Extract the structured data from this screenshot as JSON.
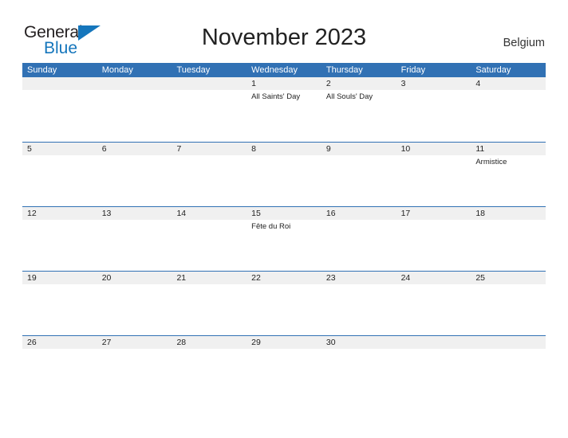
{
  "brand": {
    "name_part1": "General",
    "name_part2": "Blue",
    "triangle_color": "#1576bc",
    "text_color": "#231f20"
  },
  "header": {
    "title": "November 2023",
    "location": "Belgium",
    "header_bg_color": "#3171b4",
    "row_band_color": "#f0f0f0"
  },
  "weekdays": [
    "Sunday",
    "Monday",
    "Tuesday",
    "Wednesday",
    "Thursday",
    "Friday",
    "Saturday"
  ],
  "weeks": [
    {
      "days": [
        {
          "num": "",
          "events": []
        },
        {
          "num": "",
          "events": []
        },
        {
          "num": "",
          "events": []
        },
        {
          "num": "1",
          "events": [
            "All Saints' Day"
          ]
        },
        {
          "num": "2",
          "events": [
            "All Souls' Day"
          ]
        },
        {
          "num": "3",
          "events": []
        },
        {
          "num": "4",
          "events": []
        }
      ]
    },
    {
      "days": [
        {
          "num": "5",
          "events": []
        },
        {
          "num": "6",
          "events": []
        },
        {
          "num": "7",
          "events": []
        },
        {
          "num": "8",
          "events": []
        },
        {
          "num": "9",
          "events": []
        },
        {
          "num": "10",
          "events": []
        },
        {
          "num": "11",
          "events": [
            "Armistice"
          ]
        }
      ]
    },
    {
      "days": [
        {
          "num": "12",
          "events": []
        },
        {
          "num": "13",
          "events": []
        },
        {
          "num": "14",
          "events": []
        },
        {
          "num": "15",
          "events": [
            "Fête du Roi"
          ]
        },
        {
          "num": "16",
          "events": []
        },
        {
          "num": "17",
          "events": []
        },
        {
          "num": "18",
          "events": []
        }
      ]
    },
    {
      "days": [
        {
          "num": "19",
          "events": []
        },
        {
          "num": "20",
          "events": []
        },
        {
          "num": "21",
          "events": []
        },
        {
          "num": "22",
          "events": []
        },
        {
          "num": "23",
          "events": []
        },
        {
          "num": "24",
          "events": []
        },
        {
          "num": "25",
          "events": []
        }
      ]
    },
    {
      "days": [
        {
          "num": "26",
          "events": []
        },
        {
          "num": "27",
          "events": []
        },
        {
          "num": "28",
          "events": []
        },
        {
          "num": "29",
          "events": []
        },
        {
          "num": "30",
          "events": []
        },
        {
          "num": "",
          "events": []
        },
        {
          "num": "",
          "events": []
        }
      ]
    }
  ]
}
